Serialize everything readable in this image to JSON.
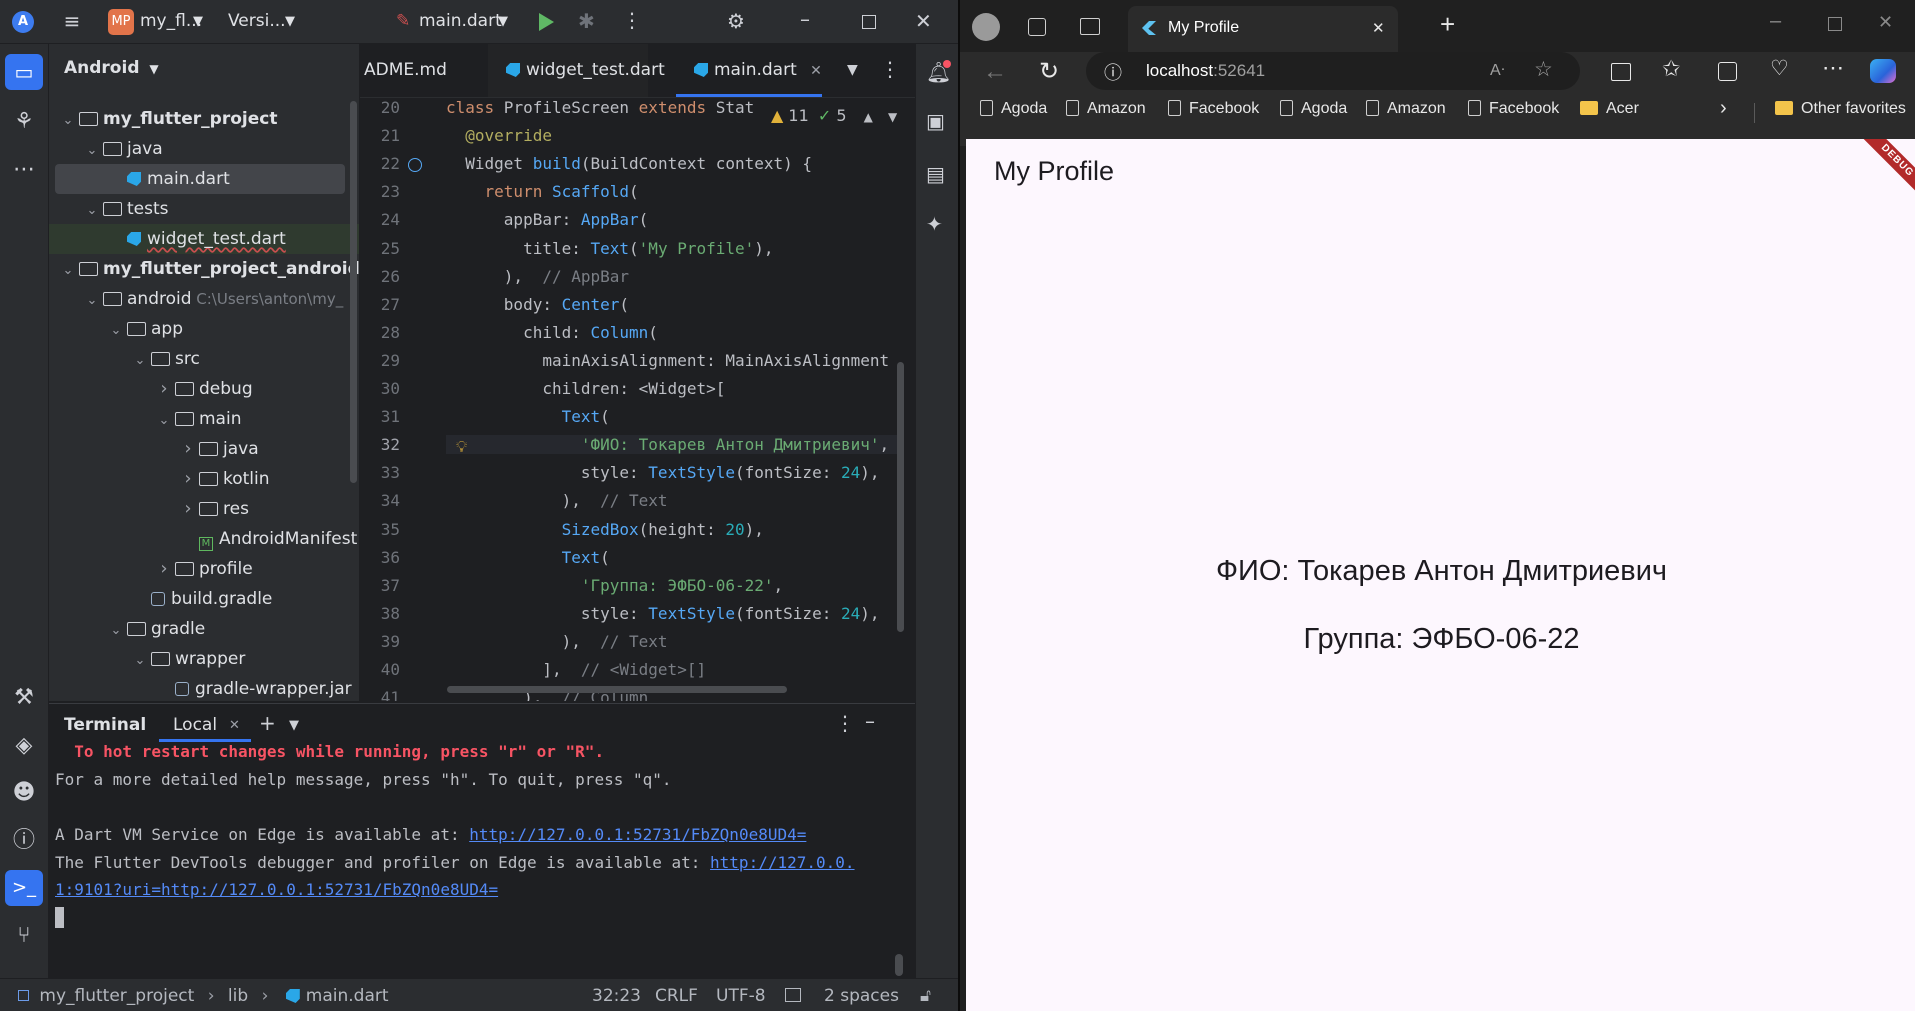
{
  "ide": {
    "project_badge": "MP",
    "project_name": "my_fl...",
    "vcs_label": "Versi...",
    "run_config": "main.dart",
    "project_view": "Android",
    "tree": [
      {
        "label": "my_flutter_project",
        "bold": true,
        "indent": 0,
        "chev": "open",
        "icon": "folder"
      },
      {
        "label": "java",
        "indent": 1,
        "chev": "open",
        "icon": "folder"
      },
      {
        "label": "main.dart",
        "indent": 2,
        "chev": "none",
        "icon": "dart",
        "selected": true
      },
      {
        "label": "tests",
        "indent": 1,
        "chev": "open",
        "icon": "folder"
      },
      {
        "label": "widget_test.dart",
        "indent": 2,
        "chev": "none",
        "icon": "dart",
        "underline": true
      },
      {
        "label": "my_flutter_project_android",
        "bold": true,
        "indent": 0,
        "chev": "open",
        "icon": "folder"
      },
      {
        "label": "android",
        "hint": "C:\\Users\\anton\\my_",
        "indent": 1,
        "chev": "open",
        "icon": "folder"
      },
      {
        "label": "app",
        "indent": 2,
        "chev": "open",
        "icon": "folder"
      },
      {
        "label": "src",
        "indent": 3,
        "chev": "open",
        "icon": "folder"
      },
      {
        "label": "debug",
        "indent": 4,
        "chev": "closed",
        "icon": "folder"
      },
      {
        "label": "main",
        "indent": 4,
        "chev": "open",
        "icon": "folder"
      },
      {
        "label": "java",
        "indent": 5,
        "chev": "closed",
        "icon": "folder"
      },
      {
        "label": "kotlin",
        "indent": 5,
        "chev": "closed",
        "icon": "folder"
      },
      {
        "label": "res",
        "indent": 5,
        "chev": "closed",
        "icon": "folder"
      },
      {
        "label": "AndroidManifest",
        "indent": 5,
        "chev": "none",
        "icon": "manifest"
      },
      {
        "label": "profile",
        "indent": 4,
        "chev": "closed",
        "icon": "folder"
      },
      {
        "label": "build.gradle",
        "indent": 3,
        "chev": "none",
        "icon": "gradle"
      },
      {
        "label": "gradle",
        "indent": 2,
        "chev": "open",
        "icon": "folder"
      },
      {
        "label": "wrapper",
        "indent": 3,
        "chev": "open",
        "icon": "folder"
      },
      {
        "label": "gradle-wrapper.jar",
        "indent": 4,
        "chev": "none",
        "icon": "gradle"
      }
    ],
    "editor_tabs": {
      "tab1": "ADME.md",
      "tab2": "widget_test.dart",
      "tab3": "main.dart"
    },
    "inspections": {
      "warnings": "11",
      "weak": "5"
    },
    "code_lines": [
      {
        "n": "20",
        "html": "<span class=\"kw\">class</span> ProfileScreen <span class=\"kw\">extends</span> Stat"
      },
      {
        "n": "21",
        "html": "  <span class=\"ann\">@override</span>"
      },
      {
        "n": "22",
        "html": "  Widget <span class=\"cls\">build</span>(BuildContext context) {"
      },
      {
        "n": "23",
        "html": "    <span class=\"kw\">return</span> <span class=\"cls\">Scaffold</span>("
      },
      {
        "n": "24",
        "html": "      appBar: <span class=\"cls\">AppBar</span>("
      },
      {
        "n": "25",
        "html": "        title: <span class=\"cls\">Text</span>(<span class=\"str\">'My Profile'</span>),"
      },
      {
        "n": "26",
        "html": "      ),  <span class=\"cmt\">// AppBar</span>"
      },
      {
        "n": "27",
        "html": "      body: <span class=\"cls\">Center</span>("
      },
      {
        "n": "28",
        "html": "        child: <span class=\"cls\">Column</span>("
      },
      {
        "n": "29",
        "html": "          mainAxisAlignment: MainAxisAlignment"
      },
      {
        "n": "30",
        "html": "          children: &lt;Widget&gt;["
      },
      {
        "n": "31",
        "html": "            <span class=\"cls\">Text</span>("
      },
      {
        "n": "32",
        "html": "              <span class=\"str\">'ФИО: Токарев Антон Дмитриевич'</span>,"
      },
      {
        "n": "33",
        "html": "              style: <span class=\"cls\">TextStyle</span>(fontSize: <span class=\"num\">24</span>),"
      },
      {
        "n": "34",
        "html": "            ),  <span class=\"cmt\">// Text</span>"
      },
      {
        "n": "35",
        "html": "            <span class=\"cls\">SizedBox</span>(height: <span class=\"num\">20</span>),"
      },
      {
        "n": "36",
        "html": "            <span class=\"cls\">Text</span>("
      },
      {
        "n": "37",
        "html": "              <span class=\"str\">'Группа: ЭФБО-06-22'</span>,"
      },
      {
        "n": "38",
        "html": "              style: <span class=\"cls\">TextStyle</span>(fontSize: <span class=\"num\">24</span>),"
      },
      {
        "n": "39",
        "html": "            ),  <span class=\"cmt\">// Text</span>"
      },
      {
        "n": "40",
        "html": "          ],  <span class=\"cmt\">// &lt;Widget&gt;[]</span>"
      },
      {
        "n": "41",
        "html": "        ),  <span class=\"cmt\">// Column</span>"
      }
    ],
    "terminal": {
      "title": "Terminal",
      "tab": "Local",
      "line1": "  To hot restart changes while running, press \"r\" or \"R\".",
      "line2": "For a more detailed help message, press \"h\". To quit, press \"q\".",
      "line3_prefix": "A Dart VM Service on Edge is available at: ",
      "line3_link": "http://127.0.0.1:52731/FbZQn0e8UD4=",
      "line4_prefix": "The Flutter DevTools debugger and profiler on Edge is available at: ",
      "line4_link": "http://127.0.0.",
      "line5_link": "1:9101?uri=http://127.0.0.1:52731/FbZQn0e8UD4="
    },
    "status": {
      "crumb1": "my_flutter_project",
      "crumb2": "lib",
      "crumb3": "main.dart",
      "position": "32:23",
      "line_sep": "CRLF",
      "encoding": "UTF-8",
      "indent": "2 spaces"
    }
  },
  "browser": {
    "tab_title": "My Profile",
    "url_host": "localhost",
    "url_port": ":52641",
    "bookmarks": [
      "Agoda",
      "Amazon",
      "Facebook",
      "Agoda",
      "Amazon",
      "Facebook",
      "Acer"
    ],
    "other_favorites": "Other favorites",
    "app": {
      "title": "My Profile",
      "line1": "ФИО: Токарев Антон Дмитриевич",
      "line2": "Группа: ЭФБО-06-22",
      "debug_banner": "DEBUG"
    }
  },
  "colors": {
    "ide_bg": "#1e1f22",
    "ide_panel": "#2b2d30",
    "accent": "#3574f0",
    "terminal_error": "#f75464",
    "app_bg": "#fdf7fe",
    "debug_banner": "#b22a2a"
  }
}
